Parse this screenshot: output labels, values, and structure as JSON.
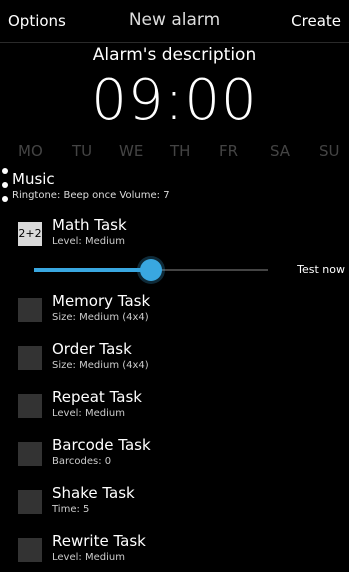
{
  "header": {
    "options_label": "Options",
    "title": "New alarm",
    "create_label": "Create"
  },
  "alarm": {
    "description": "Alarm's description",
    "time": "09:00"
  },
  "days": [
    "MO",
    "TU",
    "WE",
    "TH",
    "FR",
    "SA",
    "SU"
  ],
  "music": {
    "title": "Music",
    "details": "Ringtone: Beep once Volume: 7"
  },
  "math_task": {
    "icon_text": "2+2",
    "name": "Math Task",
    "detail": "Level: Medium"
  },
  "slider": {
    "value_fraction": 0.5,
    "test_label": "Test now"
  },
  "tasks": [
    {
      "name": "Memory Task",
      "detail": "Size: Medium (4x4)"
    },
    {
      "name": "Order Task",
      "detail": "Size: Medium (4x4)"
    },
    {
      "name": "Repeat Task",
      "detail": "Level: Medium"
    },
    {
      "name": "Barcode Task",
      "detail": "Barcodes: 0"
    },
    {
      "name": "Shake Task",
      "detail": "Time: 5"
    },
    {
      "name": "Rewrite Task",
      "detail": "Level: Medium"
    }
  ],
  "colors": {
    "accent": "#39a7e0",
    "background": "#000000"
  }
}
